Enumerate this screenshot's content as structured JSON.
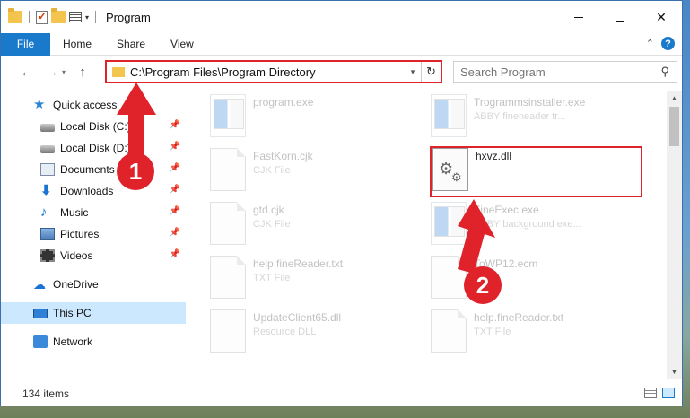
{
  "window": {
    "title": "Program",
    "controls": [
      "minimize",
      "maximize",
      "close"
    ]
  },
  "quick_access_toolbar": [
    "folder-icon",
    "properties-icon",
    "new-folder-icon",
    "customize-icon"
  ],
  "ribbon": {
    "tabs": [
      "File",
      "Home",
      "Share",
      "View"
    ],
    "help": "?"
  },
  "address": {
    "path": "C:\\Program Files\\Program Directory",
    "search_placeholder": "Search Program"
  },
  "navigation": {
    "items": [
      {
        "label": "Quick access",
        "icon": "star-icon",
        "pinned": false
      },
      {
        "label": "Local Disk (C:)",
        "icon": "disk-icon",
        "pinned": true
      },
      {
        "label": "Local Disk (D:)",
        "icon": "disk-icon",
        "pinned": true
      },
      {
        "label": "Documents",
        "icon": "documents-icon",
        "pinned": true
      },
      {
        "label": "Downloads",
        "icon": "downloads-icon",
        "pinned": true
      },
      {
        "label": "Music",
        "icon": "music-icon",
        "pinned": true
      },
      {
        "label": "Pictures",
        "icon": "pictures-icon",
        "pinned": true
      },
      {
        "label": "Videos",
        "icon": "videos-icon",
        "pinned": true
      },
      {
        "label": "OneDrive",
        "icon": "cloud-icon",
        "pinned": false
      },
      {
        "label": "This PC",
        "icon": "computer-icon",
        "pinned": false,
        "selected": true
      },
      {
        "label": "Network",
        "icon": "network-icon",
        "pinned": false
      }
    ]
  },
  "files": [
    {
      "name": "program.exe",
      "desc": "",
      "icon": "installer-icon",
      "faded": true
    },
    {
      "name": "Trogrammsinstaller.exe",
      "desc": "ABBY fineneader tr...",
      "icon": "exe-icon",
      "faded": true
    },
    {
      "name": "FastKorn.cjk",
      "desc": "CJK File",
      "icon": "document-icon",
      "faded": true
    },
    {
      "name": "hxvz.dll",
      "desc": "",
      "icon": "gear-file-icon",
      "faded": false
    },
    {
      "name": "gtd.cjk",
      "desc": "CJK File",
      "icon": "document-icon",
      "faded": true
    },
    {
      "name": "FineExec.exe",
      "desc": "ABBY background exe...",
      "icon": "exe-icon",
      "faded": true
    },
    {
      "name": "help.fineReader.txt",
      "desc": "TXT File",
      "icon": "document-icon",
      "faded": true
    },
    {
      "name": "ToWP12.ecm",
      "desc": "File",
      "icon": "document-icon",
      "faded": true
    },
    {
      "name": "UpdateClient65.dll",
      "desc": "Resource DLL",
      "icon": "gear-file-icon",
      "faded": true
    },
    {
      "name": "help.fineReader.txt",
      "desc": "TXT File",
      "icon": "document-icon",
      "faded": true
    }
  ],
  "status": {
    "item_count": "134 items"
  },
  "annotations": {
    "step1": "1",
    "step2": "2",
    "color": "#e0222a"
  }
}
